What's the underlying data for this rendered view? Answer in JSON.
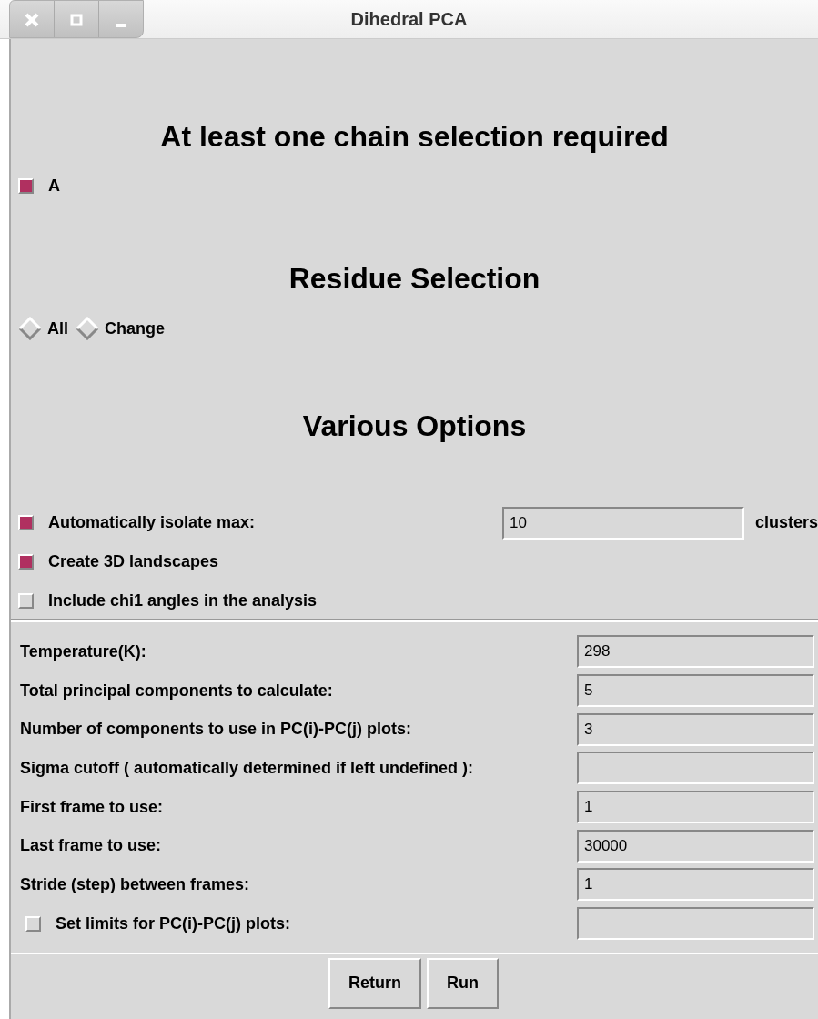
{
  "window": {
    "title": "Dihedral PCA"
  },
  "chain_section": {
    "heading": "At least one chain selection required",
    "chains": [
      {
        "label": "A",
        "checked": true
      }
    ]
  },
  "residue_section": {
    "heading": "Residue Selection",
    "options": [
      {
        "label": "All",
        "selected": false
      },
      {
        "label": "Change",
        "selected": false
      }
    ]
  },
  "options_section": {
    "heading": "Various Options",
    "options": [
      {
        "kind": "field",
        "label": "Automatically isolate max:",
        "checked": true,
        "value": "10",
        "unit": "clusters"
      },
      {
        "kind": "plain",
        "label": "Create 3D landscapes",
        "checked": true
      },
      {
        "kind": "plain",
        "label": "Include chi1 angles in the analysis",
        "checked": false
      }
    ]
  },
  "parameters": [
    {
      "kind": "text",
      "label": "Temperature(K):",
      "value": "298"
    },
    {
      "kind": "text",
      "label": "Total principal components to calculate:",
      "value": "5"
    },
    {
      "kind": "text",
      "label": "Number of components to use in PC(i)-PC(j) plots:",
      "value": "3"
    },
    {
      "kind": "text",
      "label": "Sigma cutoff ( automatically determined if left undefined ):"
    },
    {
      "kind": "text",
      "label": "First frame to use:",
      "value": "1"
    },
    {
      "kind": "text",
      "label": "Last frame to use:",
      "value": "30000"
    },
    {
      "kind": "text",
      "label": "Stride (step) between frames:",
      "value": "1"
    },
    {
      "kind": "check",
      "label": "Set limits for PC(i)-PC(j) plots:",
      "checked": false
    }
  ],
  "buttons": [
    "Return",
    "Run"
  ]
}
